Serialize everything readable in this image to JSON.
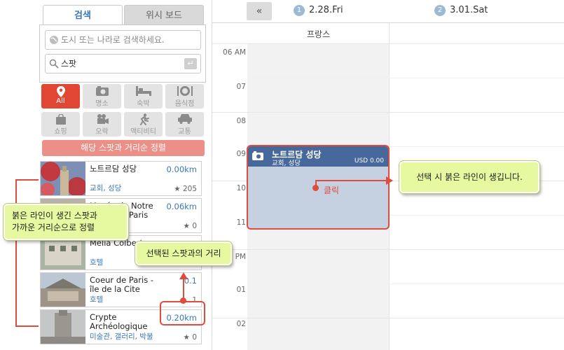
{
  "tabs": {
    "search": "검색",
    "wishboard": "위시 보드"
  },
  "search": {
    "city_placeholder": "도시 또는 나라로 검색하세요.",
    "spot_value": "스팟"
  },
  "categories": [
    {
      "label": "All",
      "icon": "pin-icon",
      "active": true
    },
    {
      "label": "명소",
      "icon": "camera-icon"
    },
    {
      "label": "숙박",
      "icon": "bed-icon"
    },
    {
      "label": "음식점",
      "icon": "dish-icon"
    },
    {
      "label": "쇼핑",
      "icon": "bag-icon"
    },
    {
      "label": "오락",
      "icon": "film-camera-icon"
    },
    {
      "label": "액티비티",
      "icon": "running-icon"
    },
    {
      "label": "교통",
      "icon": "car-icon"
    }
  ],
  "sort_button": "해당 스팟과 거리순 정렬",
  "spots": [
    {
      "name": "노트르담 성당",
      "distance": "0.00km",
      "category": "교회, 성당",
      "likes": "205"
    },
    {
      "name": "Musée de Notre Dame de Paris",
      "distance": "0.06km",
      "category": "",
      "likes": "0"
    },
    {
      "name": "Melia Colbert",
      "distance": "",
      "category": "호텔",
      "likes": ""
    },
    {
      "name": "Coeur de Paris - île de la Cite",
      "distance": "0.1",
      "category": "호텔",
      "likes": "1"
    },
    {
      "name": "Crypte Archéologique",
      "distance": "0.20km",
      "category": "미술관, 갤러리, 박물",
      "likes": "0"
    }
  ],
  "calendar": {
    "collapse": "«",
    "days": [
      {
        "num": "1",
        "label": "2.28.Fri"
      },
      {
        "num": "2",
        "label": "3.01.Sat"
      }
    ],
    "column_label": "프랑스",
    "hours": [
      "06 AM",
      "07",
      "08",
      "09",
      "10",
      "11",
      "12 PM",
      "01",
      "02"
    ]
  },
  "event": {
    "title": "노트르담 성당",
    "subtitle": "교회, 성당",
    "cost": "USD 0.00",
    "icon": "camera-icon"
  },
  "annotations": {
    "click": "클릭",
    "red_line": "선택 시 붉은 라인이 생깁니다.",
    "sorted": "붉은 라인이 생긴 스팟과\n가까운 거리순으로 정렬",
    "distance": "선택된 스팟과의 거리"
  },
  "colors": {
    "accent_red": "#e04b3c",
    "link_blue": "#3b78b5",
    "event_header": "#47689b",
    "callout": "#e6f8a0"
  }
}
